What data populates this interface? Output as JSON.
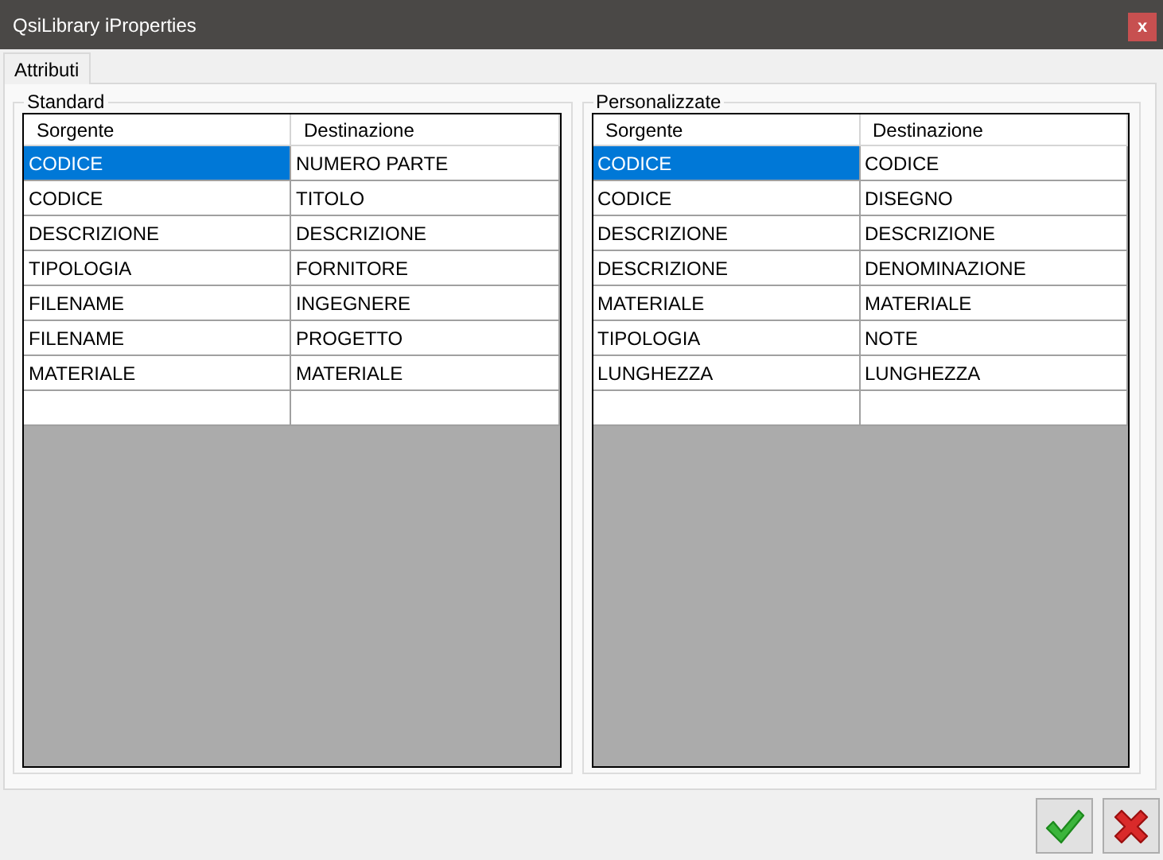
{
  "window": {
    "title": "QsiLibrary iProperties",
    "close": "x"
  },
  "tabs": [
    {
      "label": "Attributi",
      "selected": true
    }
  ],
  "groups": [
    {
      "title": "Standard",
      "columns": [
        "Sorgente",
        "Destinazione"
      ],
      "rows": [
        {
          "cells": [
            {
              "text": "CODICE",
              "selected": true
            },
            {
              "text": "NUMERO PARTE",
              "selected": false
            }
          ]
        },
        {
          "cells": [
            {
              "text": "CODICE",
              "selected": false
            },
            {
              "text": "TITOLO",
              "selected": false
            }
          ]
        },
        {
          "cells": [
            {
              "text": "DESCRIZIONE",
              "selected": false
            },
            {
              "text": "DESCRIZIONE",
              "selected": false
            }
          ]
        },
        {
          "cells": [
            {
              "text": "TIPOLOGIA",
              "selected": false
            },
            {
              "text": "FORNITORE",
              "selected": false
            }
          ]
        },
        {
          "cells": [
            {
              "text": "FILENAME",
              "selected": false
            },
            {
              "text": "INGEGNERE",
              "selected": false
            }
          ]
        },
        {
          "cells": [
            {
              "text": "FILENAME",
              "selected": false
            },
            {
              "text": "PROGETTO",
              "selected": false
            }
          ]
        },
        {
          "cells": [
            {
              "text": "MATERIALE",
              "selected": false
            },
            {
              "text": "MATERIALE",
              "selected": false
            }
          ]
        }
      ]
    },
    {
      "title": "Personalizzate",
      "columns": [
        "Sorgente",
        "Destinazione"
      ],
      "rows": [
        {
          "cells": [
            {
              "text": "CODICE",
              "selected": true
            },
            {
              "text": "CODICE",
              "selected": false
            }
          ]
        },
        {
          "cells": [
            {
              "text": "CODICE",
              "selected": false
            },
            {
              "text": "DISEGNO",
              "selected": false
            }
          ]
        },
        {
          "cells": [
            {
              "text": "DESCRIZIONE",
              "selected": false
            },
            {
              "text": "DESCRIZIONE",
              "selected": false
            }
          ]
        },
        {
          "cells": [
            {
              "text": "DESCRIZIONE",
              "selected": false
            },
            {
              "text": "DENOMINAZIONE",
              "selected": false
            }
          ]
        },
        {
          "cells": [
            {
              "text": "MATERIALE",
              "selected": false
            },
            {
              "text": "MATERIALE",
              "selected": false
            }
          ]
        },
        {
          "cells": [
            {
              "text": "TIPOLOGIA",
              "selected": false
            },
            {
              "text": "NOTE",
              "selected": false
            }
          ]
        },
        {
          "cells": [
            {
              "text": "LUNGHEZZA",
              "selected": false
            },
            {
              "text": "LUNGHEZZA",
              "selected": false
            }
          ]
        }
      ]
    }
  ]
}
